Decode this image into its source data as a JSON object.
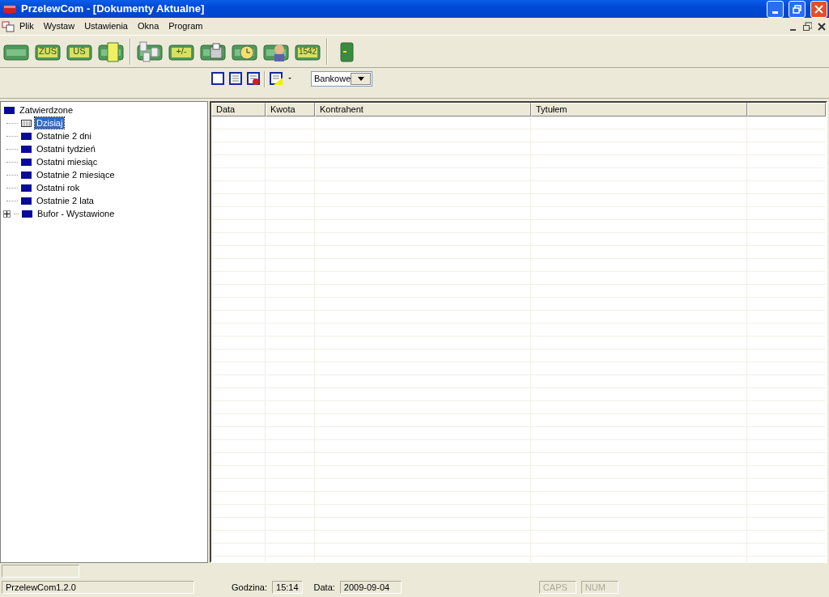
{
  "window": {
    "title": "PrzelewCom - [Dokumenty Aktualne]"
  },
  "menu": [
    "Plik",
    "Wystaw",
    "Ustawienia",
    "Okna",
    "Program"
  ],
  "toolbar": [
    {
      "kind": "board"
    },
    {
      "kind": "label",
      "label": "ZUS"
    },
    {
      "kind": "label",
      "label": "US"
    },
    {
      "kind": "doc"
    },
    {
      "kind": "sep"
    },
    {
      "kind": "docs"
    },
    {
      "kind": "label",
      "label": "+/-"
    },
    {
      "kind": "printer"
    },
    {
      "kind": "clock"
    },
    {
      "kind": "person"
    },
    {
      "kind": "label",
      "label": "1542"
    },
    {
      "kind": "sep"
    },
    {
      "kind": "exit"
    }
  ],
  "subtoolbar": {
    "filter_select": "Bankowe"
  },
  "tree": {
    "label": "Zatwierdzone",
    "children": [
      {
        "label": "Dzisiaj",
        "selected": true,
        "expander": false
      },
      {
        "label": "Ostatnie 2 dni",
        "selected": false,
        "expander": false
      },
      {
        "label": "Ostatni tydzień",
        "selected": false,
        "expander": false
      },
      {
        "label": "Ostatni miesiąc",
        "selected": false,
        "expander": false
      },
      {
        "label": "Ostatnie 2 miesiące",
        "selected": false,
        "expander": false
      },
      {
        "label": "Ostatni rok",
        "selected": false,
        "expander": false
      },
      {
        "label": "Ostatnie 2 lata",
        "selected": false,
        "expander": false
      },
      {
        "label": "Bufor - Wystawione",
        "selected": false,
        "expander": true
      }
    ]
  },
  "table": {
    "columns": [
      "Data",
      "Kwota",
      "Kontrahent",
      "Tytułem"
    ]
  },
  "status_bar": {
    "version": "PrzelewCom1.2.0",
    "time_label": "Godzina:",
    "time": "15:14",
    "date_label": "Data:",
    "date": "2009-09-04",
    "indicators": [
      {
        "label": "CAPS",
        "active": false
      },
      {
        "label": "NUM",
        "active": false
      }
    ]
  }
}
